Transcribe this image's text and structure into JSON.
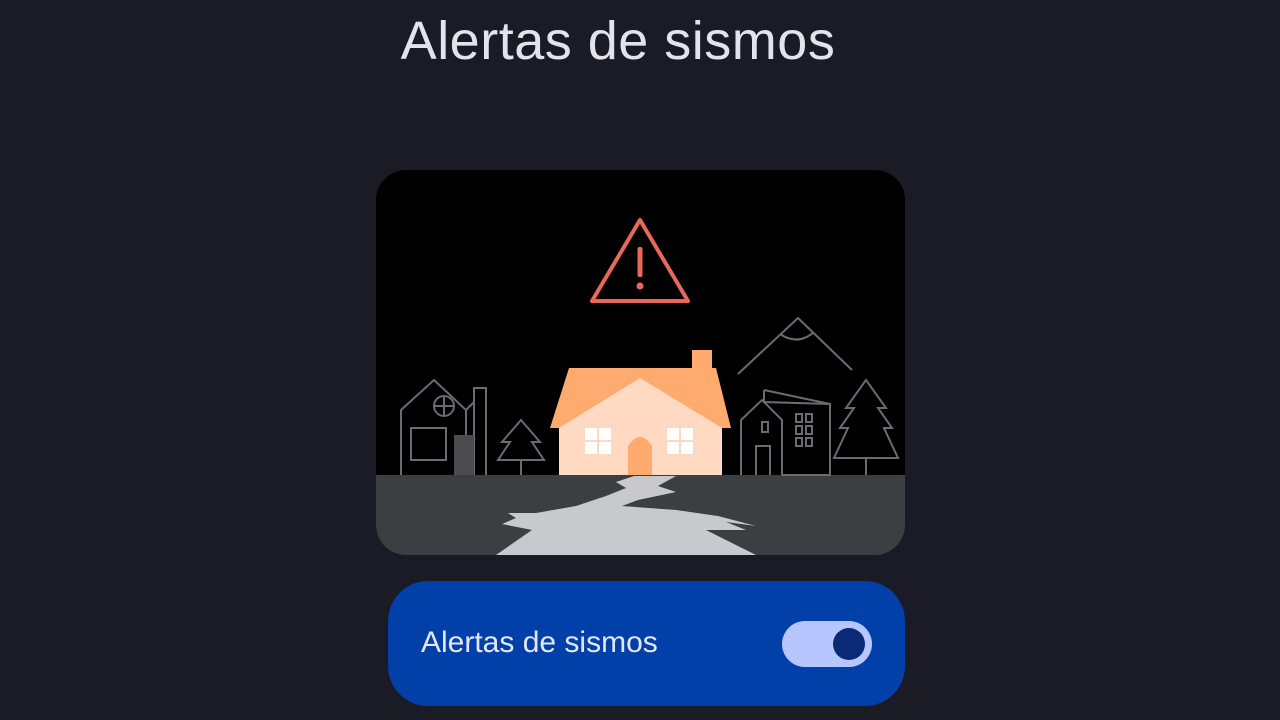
{
  "page": {
    "title": "Alertas de sismos"
  },
  "illustration": {
    "icons": [
      "warning-triangle-icon",
      "house-icon",
      "tree-icon",
      "mountain-icon",
      "ground-crack"
    ],
    "colors": {
      "background": "#000000",
      "warning": "#e8695c",
      "house_roof": "#ffab70",
      "house_wall": "#ffd9c2",
      "outline": "#6b6b70",
      "ground": "#3d3e42",
      "crack": "#c7c9cc"
    }
  },
  "setting": {
    "label": "Alertas de sismos",
    "toggle_on": true
  },
  "colors": {
    "background": "#1a1b24",
    "card": "#0040a8",
    "switch_track": "#b8c6ff",
    "switch_thumb": "#0a2a78"
  }
}
